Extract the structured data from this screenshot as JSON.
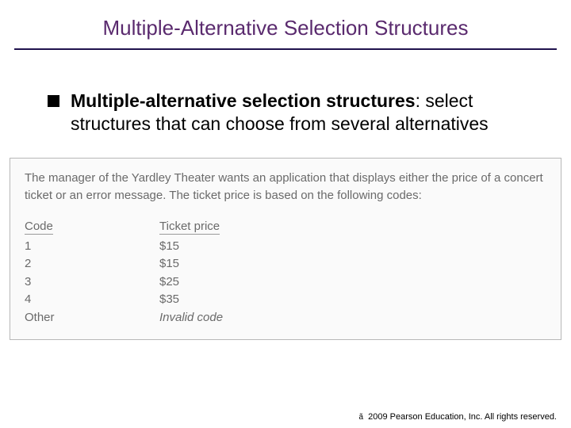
{
  "title": "Multiple-Alternative Selection Structures",
  "bullet": {
    "term": "Multiple-alternative selection structures",
    "rest": ": select structures that can choose from several alternatives"
  },
  "figure": {
    "description": "The manager of the Yardley Theater wants an application that displays either the price of a concert ticket or an error message. The ticket price is based on the following codes:",
    "headers": {
      "code": "Code",
      "price": "Ticket price"
    },
    "rows": [
      {
        "code": "1",
        "price": "$15"
      },
      {
        "code": "2",
        "price": "$15"
      },
      {
        "code": "3",
        "price": "$25"
      },
      {
        "code": "4",
        "price": "$35"
      },
      {
        "code": "Other",
        "price": "Invalid code"
      }
    ]
  },
  "footer": {
    "symbol": "ã",
    "text": " 2009 Pearson Education, Inc.  All rights reserved."
  },
  "chart_data": {
    "type": "table",
    "title": "Ticket price by code",
    "columns": [
      "Code",
      "Ticket price"
    ],
    "rows": [
      [
        "1",
        "$15"
      ],
      [
        "2",
        "$15"
      ],
      [
        "3",
        "$25"
      ],
      [
        "4",
        "$35"
      ],
      [
        "Other",
        "Invalid code"
      ]
    ]
  }
}
